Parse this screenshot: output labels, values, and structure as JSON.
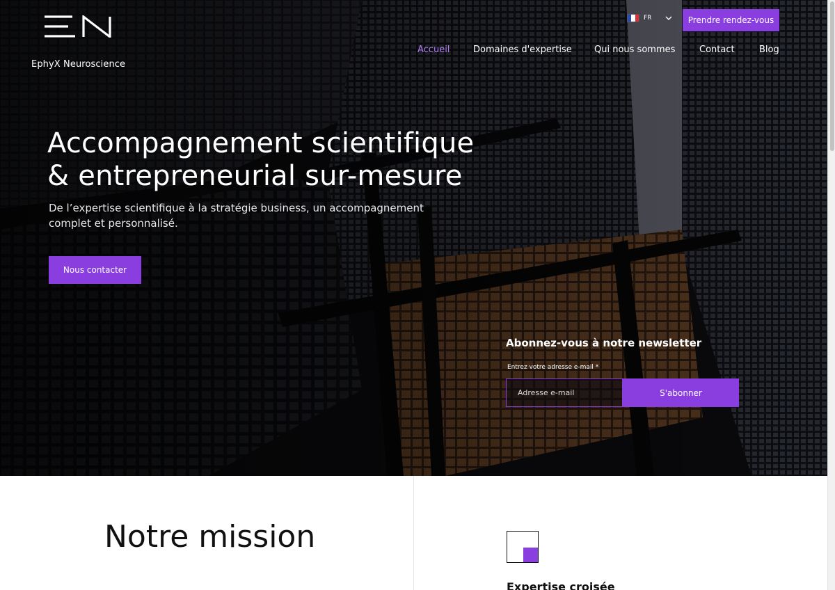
{
  "brand": {
    "name": "EphyX Neuroscience",
    "accent_color": "#8a3ee0",
    "logo_icon": "en-monogram-logo"
  },
  "header": {
    "language": {
      "code": "FR",
      "flag_icon": "france-flag-icon",
      "dropdown_icon": "chevron-down-icon"
    },
    "cta_label": "Prendre rendez-vous",
    "nav": [
      {
        "label": "Accueil",
        "active": true
      },
      {
        "label": "Domaines d'expertise",
        "active": false
      },
      {
        "label": "Qui nous sommes",
        "active": false
      },
      {
        "label": "Contact",
        "active": false
      },
      {
        "label": "Blog",
        "active": false
      }
    ]
  },
  "hero": {
    "headline_line1": "Accompagnement scientifique",
    "headline_line2": "& entrepreneurial sur-mesure",
    "subheadline": "De l’expertise scientifique à la stratégie business, un accompagnement complet et personnalisé.",
    "cta_label": "Nous contacter",
    "background": "dark-skyscrapers-photo"
  },
  "newsletter": {
    "title": "Abonnez-vous à notre newsletter",
    "label": "Entrez votre adresse e-mail *",
    "placeholder": "Adresse e-mail",
    "value": "",
    "button_label": "S'abonner"
  },
  "mission": {
    "title": "Notre mission",
    "feature_icon": "split-square-icon",
    "feature_title": "Expertise croisée"
  }
}
